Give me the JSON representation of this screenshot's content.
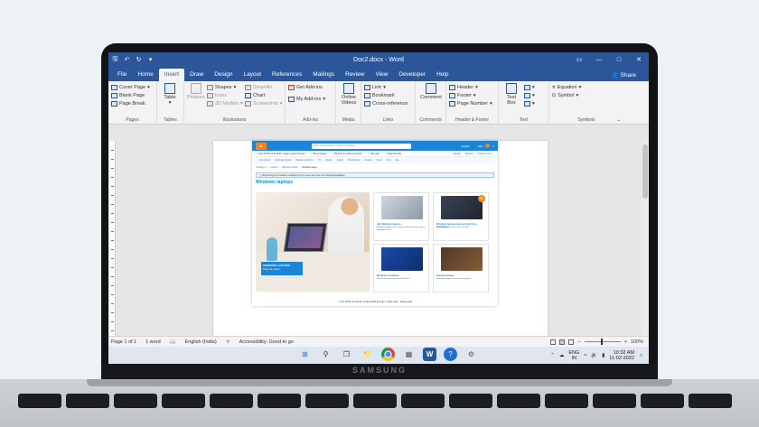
{
  "laptop": {
    "brand": "SAMSUNG"
  },
  "window": {
    "title": "Doc2.docx - Word",
    "quick_access": {
      "save_icon": "save-icon",
      "undo_icon": "undo-icon",
      "redo_icon": "redo-icon",
      "customize_icon": "chevron-down-icon"
    },
    "controls": [
      "minimize-icon",
      "maximize-icon",
      "close-icon"
    ],
    "ribbon_options_icon": "ribbon-display-icon"
  },
  "menu": {
    "tabs": [
      "File",
      "Home",
      "Insert",
      "Draw",
      "Design",
      "Layout",
      "References",
      "Mailings",
      "Review",
      "View",
      "Developer",
      "Help"
    ],
    "active": "Insert",
    "share": "Share"
  },
  "ribbon": {
    "pages": {
      "items": [
        "Cover Page",
        "Blank Page",
        "Page Break"
      ],
      "name": "Pages"
    },
    "tables": {
      "table": "Table",
      "name": "Tables"
    },
    "illustrations": {
      "pictures": "Pictures",
      "shapes": "Shapes",
      "icons": "Icons",
      "models": "3D Models",
      "smartart": "SmartArt",
      "chart": "Chart",
      "screenshot": "Screenshot",
      "name": "Illustrations"
    },
    "addins": {
      "get": "Get Add-ins",
      "my": "My Add-ins",
      "name": "Add-ins"
    },
    "media": {
      "online_videos": [
        "Online",
        "Videos"
      ],
      "name": "Media"
    },
    "links": {
      "items": [
        "Link",
        "Bookmark",
        "Cross-reference"
      ],
      "name": "Links"
    },
    "comments": {
      "comment": "Comment",
      "name": "Comments"
    },
    "header_footer": {
      "items": [
        "Header",
        "Footer",
        "Page Number"
      ],
      "name": "Header & Footer"
    },
    "text": {
      "textbox": [
        "Text",
        "Box"
      ],
      "name": "Text"
    },
    "symbols": {
      "equation": "Equation",
      "symbol": "Symbol",
      "name": "Symbols"
    }
  },
  "embedded_page": {
    "search_placeholder": "Zoek naar producten, merken en artikelen",
    "header_links": [
      "English",
      "Mijn",
      "0"
    ],
    "usps": [
      "Voor 23:59 uur besteld, morgen gratis bezorgd",
      "Wij verzorgen",
      "Bij fiets en Gratis vervoeren",
      "Ook stap",
      "Volgende dag"
    ],
    "usps_right": [
      "Zakelijk",
      "Winkels",
      "Klantenservice"
    ],
    "nav": [
      "Computers",
      "Gaming & Apple",
      "Mobiele telefoons",
      "TV",
      "Wonen",
      "Koken",
      "Huishouden",
      "Fietsen",
      "Sport",
      "Tuin",
      "Alle"
    ],
    "breadcrumb": [
      "Coolblue.nl",
      "Laptops",
      "Windows laptops",
      "Windows laptop"
    ],
    "notice": "Wij verzorgen en bewaren je laptops bij ons. Lees meer over ons verkoopvoorwaarden.",
    "title": "Windows laptops",
    "hero_cta": "WINDOWS LAPTOPS",
    "hero_sub": "Bekijk alle laptops",
    "cards": [
      {
        "title": "Alle Windows laptops",
        "desc": "Windows laptops met een groot scherm, perfect voor je dagelijkse taken."
      },
      {
        "title": "Windows laptops met een Intel Core processor",
        "desc": "Krachtige laptops voor werk en studie."
      },
      {
        "title": "Windows 11 laptops",
        "desc": "Met de nieuwste versie van Windows."
      },
      {
        "title": "Gaming laptops",
        "desc": "Krachtige laptops voor de beste games."
      }
    ],
    "discount_badge": "%",
    "footer": "Voor 23:59 uur besteld, morgen gratis bezorgd · Gratis retour · Kopen gratis"
  },
  "status": {
    "page": "Page 1 of 1",
    "words": "1 word",
    "language": "English (India)",
    "accessibility": "Accessibility: Good to go",
    "zoom": "100%"
  },
  "taskbar": {
    "apps": [
      "windows-start-icon",
      "search-icon",
      "task-view-icon",
      "file-explorer-icon",
      "chrome-icon",
      "settings-icon",
      "word-icon",
      "help-icon",
      "gear-icon"
    ],
    "lang": [
      "ENG",
      "IN"
    ],
    "time": "10:32 AM",
    "date": "11-02-2022"
  }
}
